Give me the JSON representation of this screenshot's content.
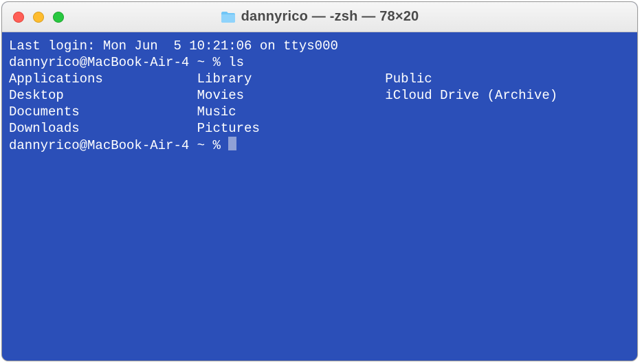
{
  "window": {
    "title": "dannyrico — -zsh — 78×20"
  },
  "terminal": {
    "last_login": "Last login: Mon Jun  5 10:21:06 on ttys000",
    "prompt1": "dannyrico@MacBook-Air-4 ~ % ",
    "command1": "ls",
    "listing": {
      "col1": [
        "Applications",
        "Desktop",
        "Documents",
        "Downloads"
      ],
      "col2": [
        "Library",
        "Movies",
        "Music",
        "Pictures"
      ],
      "col3": [
        "Public",
        "iCloud Drive (Archive)"
      ]
    },
    "prompt2": "dannyrico@MacBook-Air-4 ~ % "
  },
  "colors": {
    "background": "#2b4fb8",
    "text": "#ffffff"
  }
}
